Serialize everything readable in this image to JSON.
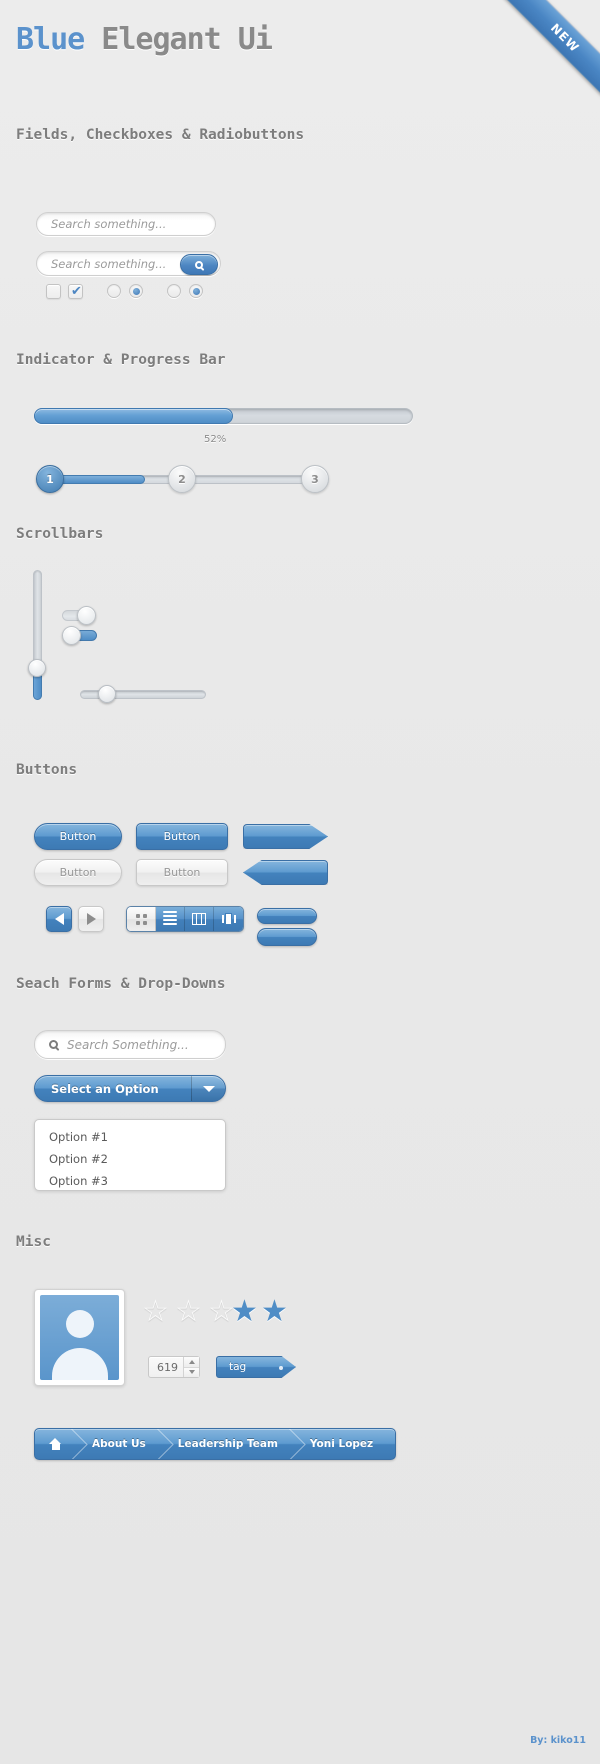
{
  "ribbon": {
    "label": "NEW"
  },
  "header": {
    "title_blue": "Blue",
    "title_rest": " Elegant Ui"
  },
  "sections": {
    "fields": "Fields, Checkboxes & Radiobuttons",
    "indicator": "Indicator & Progress Bar",
    "scrollbars": "Scrollbars",
    "buttons": "Buttons",
    "search_forms": "Seach Forms & Drop-Downs",
    "misc": "Misc"
  },
  "fields": {
    "search_plain_placeholder": "Search something...",
    "search_with_button_placeholder": "Search something...",
    "search_icon": "magnifier-icon",
    "checkbox_unchecked": "",
    "checkbox_checked_mark": "✔"
  },
  "progress": {
    "percent_label": "52%",
    "percent_value": 52,
    "steps": [
      {
        "label": "1",
        "state": "active"
      },
      {
        "label": "2",
        "state": "inactive"
      },
      {
        "label": "3",
        "state": "inactive"
      }
    ]
  },
  "buttons": {
    "blue_pill": "Button",
    "blue_rect": "Button",
    "gray_pill": "Button",
    "gray_rect": "Button",
    "prev_icon": "triangle-left-icon",
    "next_icon": "triangle-right-icon",
    "segments": [
      {
        "icon": "grid-view-icon",
        "state": "active"
      },
      {
        "icon": "list-view-icon",
        "state": "inactive"
      },
      {
        "icon": "column-view-icon",
        "state": "inactive"
      },
      {
        "icon": "coverflow-view-icon",
        "state": "inactive"
      }
    ]
  },
  "search_form": {
    "placeholder": "Search Something...",
    "icon": "magnifier-icon"
  },
  "dropdown": {
    "selected": "Select an Option",
    "caret_icon": "caret-down-icon",
    "options": [
      "Option #1",
      "Option #2",
      "Option #3"
    ]
  },
  "misc": {
    "avatar_alt": "user-avatar",
    "rating": {
      "total": 5,
      "filled": 2,
      "empty_glyph": "☆",
      "full_glyph": "★"
    },
    "stepper_value": "619",
    "tag_label": "tag"
  },
  "breadcrumb": {
    "home_icon": "home-icon",
    "items": [
      "About Us",
      "Leadership Team",
      "Yoni Lopez"
    ]
  },
  "footer": {
    "credit": "By: kiko11"
  },
  "colors": {
    "accent_blue": "#4f8dc6",
    "accent_blue_light": "#85b5dd",
    "background": "#eaeaea",
    "heading_gray": "#7d7d7d"
  }
}
